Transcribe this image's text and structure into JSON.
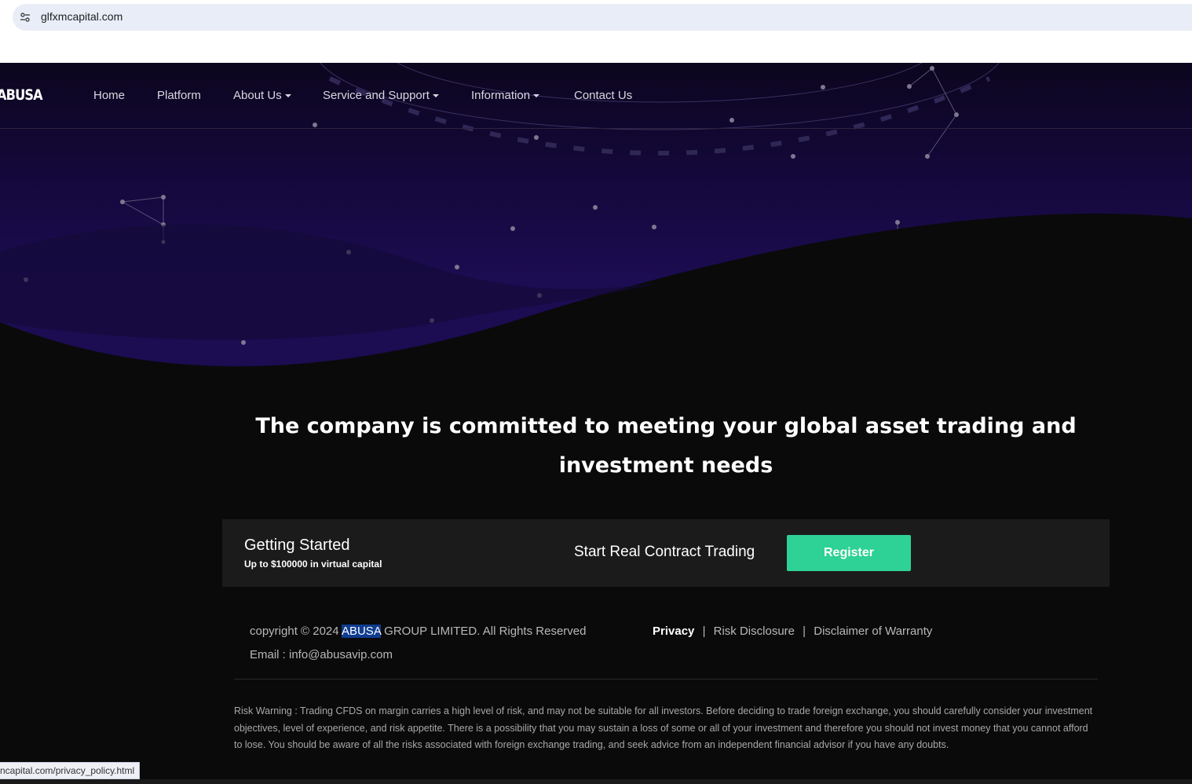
{
  "browser": {
    "url": "glfxmcapital.com",
    "status_url": "ncapital.com/privacy_policy.html"
  },
  "nav": {
    "logo": "ABUSA",
    "items": [
      {
        "label": "Home",
        "dropdown": false
      },
      {
        "label": "Platform",
        "dropdown": false
      },
      {
        "label": "About Us",
        "dropdown": true
      },
      {
        "label": "Service and Support",
        "dropdown": true
      },
      {
        "label": "Information",
        "dropdown": true
      },
      {
        "label": "Contact Us",
        "dropdown": false
      }
    ]
  },
  "hero": {
    "headline": "The company is committed to meeting your global asset trading and investment needs"
  },
  "cta": {
    "title": "Getting Started",
    "subtitle": "Up to $100000 in virtual capital",
    "middle_text": "Start Real Contract Trading",
    "register_label": "Register"
  },
  "footer": {
    "copyright_prefix": "copyright © 2024 ",
    "copyright_brand": "ABUSA",
    "copyright_suffix": " GROUP LIMITED. All Rights Reserved",
    "email": "Email : info@abusavip.com",
    "links": {
      "privacy": "Privacy",
      "risk": "Risk Disclosure",
      "disclaimer": "Disclaimer of Warranty",
      "separator": "|"
    },
    "risk_warning": "Risk Warning : Trading CFDS on margin carries a high level of risk, and may not be suitable for all investors. Before deciding to trade foreign exchange, you should carefully consider your investment objectives, level of experience, and risk appetite. There is a possibility that you may sustain a loss of some or all of your investment and therefore you should not invest money that you cannot afford to lose. You should be aware of all the risks associated with foreign exchange trading, and seek advice from an independent financial advisor if you have any doubts."
  },
  "colors": {
    "hero_top": "#0d0720",
    "hero_mid": "#1a0b4a",
    "page_bg": "#0a0a0a",
    "accent": "#2ed196",
    "highlight": "#0f3c8f"
  }
}
